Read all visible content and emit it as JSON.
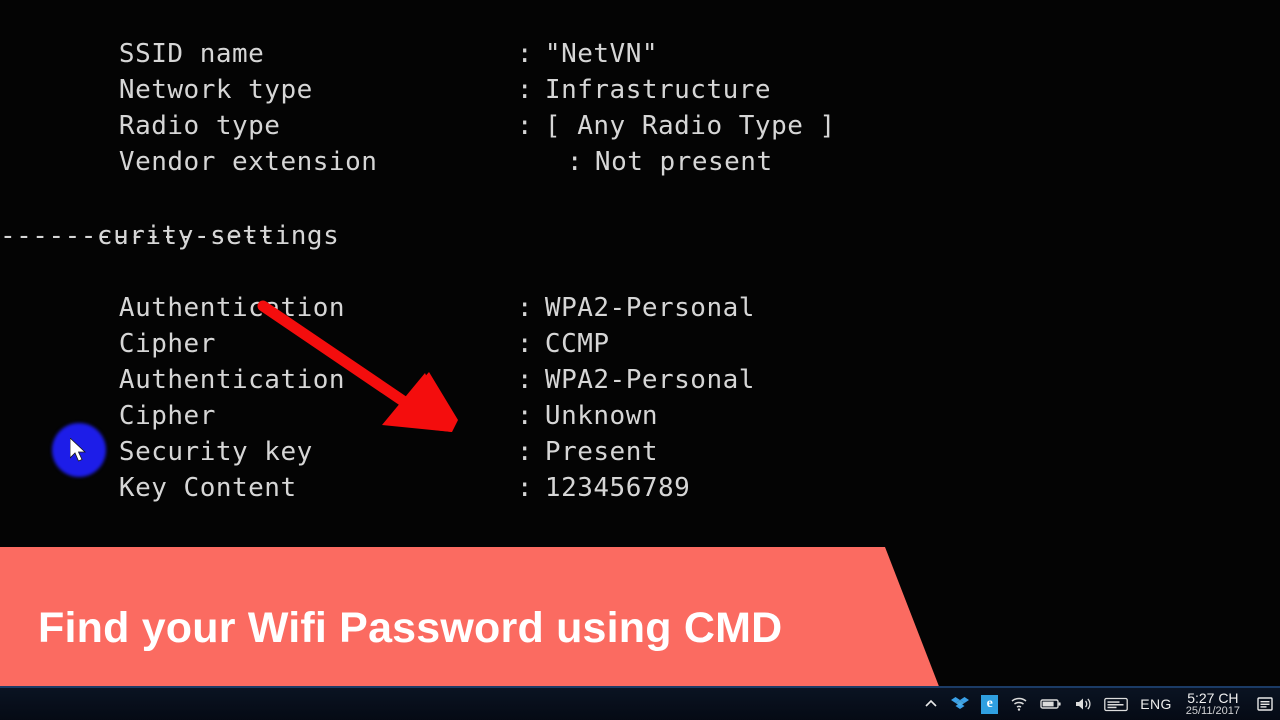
{
  "console": {
    "text_color": "#d6d6d6",
    "background": "#040404",
    "lines": [
      {
        "label": "SSID name",
        "colon": ":",
        "value": "\"NetVN\""
      },
      {
        "label": "Network type",
        "colon": ":",
        "value": "Infrastructure"
      },
      {
        "label": "Radio type",
        "colon": ":",
        "value": "[ Any Radio Type ]"
      },
      {
        "label": "Vendor extension",
        "colon": ":",
        "value": "Not present"
      },
      {
        "label": "Authentication",
        "colon": ":",
        "value": "WPA2-Personal"
      },
      {
        "label": "Cipher",
        "colon": ":",
        "value": "CCMP"
      },
      {
        "label": "Authentication",
        "colon": ":",
        "value": "WPA2-Personal"
      },
      {
        "label": "Cipher",
        "colon": ":",
        "value": "Unknown"
      },
      {
        "label": "Security key",
        "colon": ":",
        "value": "Present"
      },
      {
        "label": "Key Content",
        "colon": ":",
        "value": "123456789"
      }
    ],
    "section_security": "curity settings",
    "section_divider": "-----------------",
    "section_cost": "st settings"
  },
  "annotation": {
    "arrow_color": "#f40d0d",
    "cursor_highlight_color": "#1d1de8"
  },
  "banner": {
    "title": "Find your Wifi Password using CMD",
    "background_color": "#fb6b61",
    "text_color": "#ffffff"
  },
  "taskbar": {
    "tray_icons": [
      "chevron-up-icon",
      "dropbox-icon",
      "internet-explorer-icon",
      "wifi-icon",
      "battery-icon",
      "volume-icon",
      "keyboard-icon"
    ],
    "language": "ENG",
    "clock_time": "5:27 CH",
    "clock_date": "25/11/2017",
    "action_center": "action-center-icon"
  }
}
